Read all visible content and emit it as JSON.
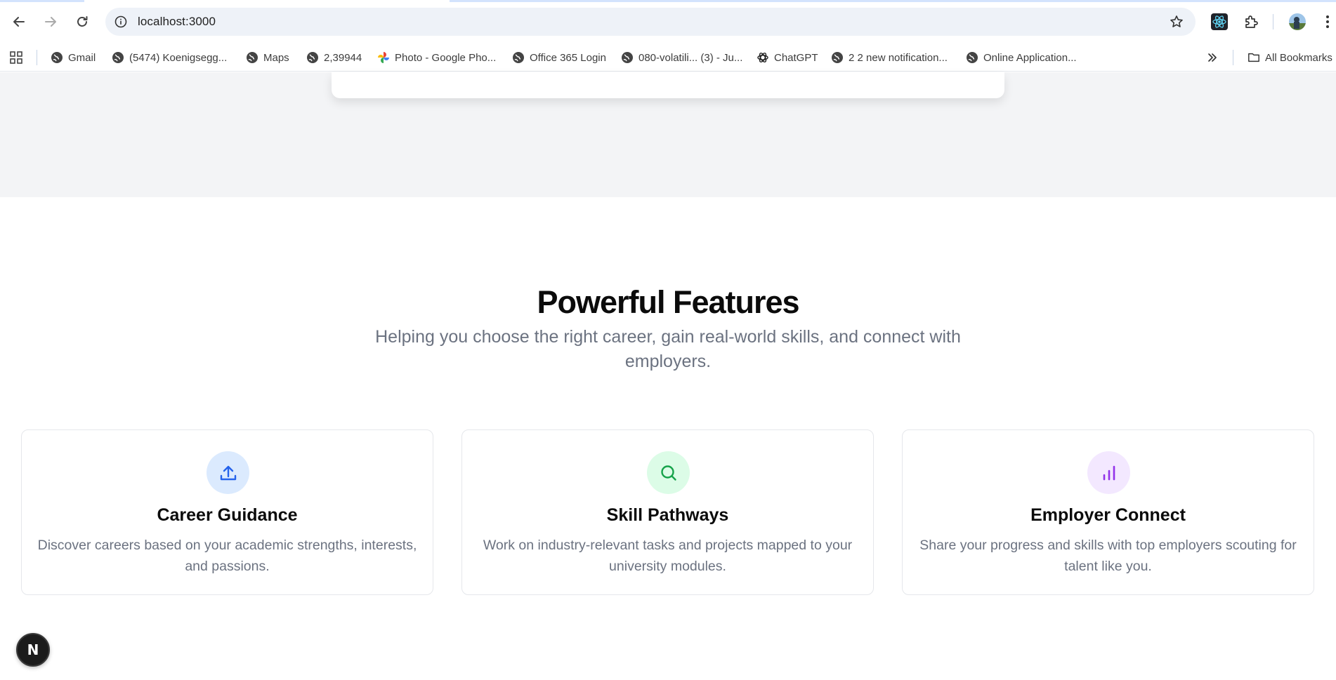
{
  "browser": {
    "url": "localhost:3000",
    "bookmarks": [
      {
        "label": "Gmail",
        "icon": "globe-icon"
      },
      {
        "label": "(5474) Koenigsegg...",
        "icon": "globe-icon"
      },
      {
        "label": "Maps",
        "icon": "globe-icon"
      },
      {
        "label": "2,39944",
        "icon": "globe-icon"
      },
      {
        "label": "Photo - Google Pho...",
        "icon": "google-photos-icon"
      },
      {
        "label": "Office 365 Login",
        "icon": "globe-icon"
      },
      {
        "label": "080-volatili... (3) - Ju...",
        "icon": "globe-icon"
      },
      {
        "label": "ChatGPT",
        "icon": "chatgpt-icon"
      },
      {
        "label": "2 2 new notification...",
        "icon": "globe-icon"
      },
      {
        "label": "Online Application...",
        "icon": "globe-icon"
      }
    ],
    "all_bookmarks_label": "All Bookmarks"
  },
  "features": {
    "title": "Powerful Features",
    "subtitle": "Helping you choose the right career, gain real-world skills, and connect with employers.",
    "cards": [
      {
        "title": "Career Guidance",
        "description": "Discover careers based on your academic strengths, interests, and passions.",
        "icon": "upload-icon",
        "color": "#2563eb",
        "bg": "#dbeafe"
      },
      {
        "title": "Skill Pathways",
        "description": "Work on industry-relevant tasks and projects mapped to your university modules.",
        "icon": "search-icon",
        "color": "#16a34a",
        "bg": "#dcfce7"
      },
      {
        "title": "Employer Connect",
        "description": "Share your progress and skills with top employers scouting for talent like you.",
        "icon": "bar-chart-icon",
        "color": "#9333ea",
        "bg": "#f3e8ff"
      }
    ]
  },
  "dev_badge": {
    "label": "N"
  }
}
